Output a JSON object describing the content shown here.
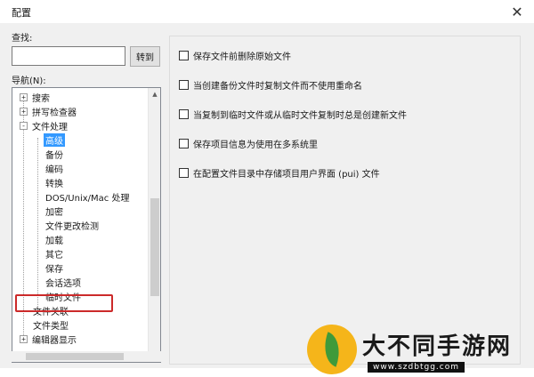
{
  "window": {
    "title": "配置"
  },
  "search": {
    "label": "查找:",
    "value": "",
    "placeholder": "",
    "goto_label": "转到"
  },
  "nav": {
    "label": "导航(N):",
    "items": [
      {
        "label": "搜索",
        "expander": "+"
      },
      {
        "label": "拼写检查器",
        "expander": "+"
      },
      {
        "label": "文件处理",
        "expander": "-"
      },
      {
        "label": "高级"
      },
      {
        "label": "备份"
      },
      {
        "label": "编码"
      },
      {
        "label": "转换"
      },
      {
        "label": "DOS/Unix/Mac 处理"
      },
      {
        "label": "加密"
      },
      {
        "label": "文件更改检测"
      },
      {
        "label": "加载"
      },
      {
        "label": "其它"
      },
      {
        "label": "保存"
      },
      {
        "label": "会话选项"
      },
      {
        "label": "临时文件"
      },
      {
        "label": "文件关联"
      },
      {
        "label": "文件类型"
      },
      {
        "label": "编辑器显示",
        "expander": "+"
      }
    ]
  },
  "options": [
    "保存文件前删除原始文件",
    "当创建备份文件时复制文件而不使用重命名",
    "当复制到临时文件或从临时文件复制时总是创建新文件",
    "保存项目信息为使用在多系统里",
    "在配置文件目录中存储项目用户界面 (pui) 文件"
  ],
  "watermark": {
    "text": "大不同手游网",
    "url": "www.szdbtgg.com"
  }
}
